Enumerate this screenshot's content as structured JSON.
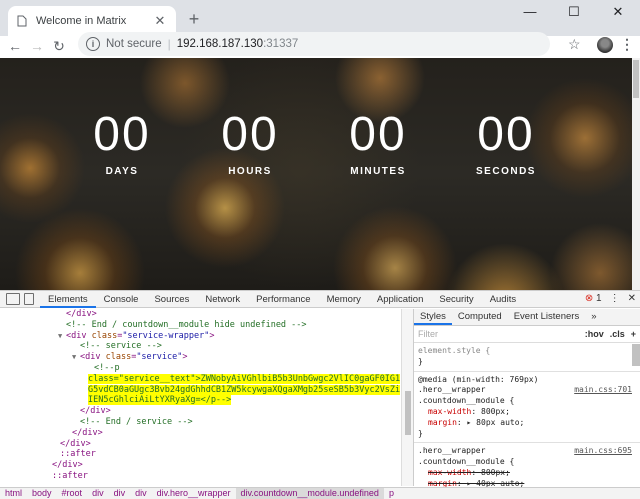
{
  "browser": {
    "tab_title": "Welcome in Matrix",
    "tab_close": "✕",
    "new_tab": "+",
    "win_min": "—",
    "win_max": "☐",
    "win_close": "✕",
    "security_label": "Not secure",
    "url_host": "192.168.187.130",
    "url_port": ":31337"
  },
  "countdown": [
    {
      "value": "00",
      "label": "DAYS"
    },
    {
      "value": "00",
      "label": "HOURS"
    },
    {
      "value": "00",
      "label": "MINUTES"
    },
    {
      "value": "00",
      "label": "SECONDS"
    }
  ],
  "devtools": {
    "tabs": [
      "Elements",
      "Console",
      "Sources",
      "Network",
      "Performance",
      "Memory",
      "Application",
      "Security",
      "Audits"
    ],
    "active_tab": "Elements",
    "error_count": "1",
    "more": "⋮",
    "close": "✕",
    "dom_lines": {
      "l1": "</div>",
      "l2": "<!-- End / countdown__module hide undefined -->",
      "l3_tag": "<div ",
      "l3_attr": "class",
      "l3_val": "\"service-wrapper\"",
      "l4": "<!-- service -->",
      "l5_tag": "<div ",
      "l5_attr": "class",
      "l5_val": "\"service\"",
      "l6": "<!--p",
      "l7": "class=\"service__text\">ZWNobyAiVGhlbiB5b3UnbGwgc2VlIC0gaGF0IG10IG1zIGc",
      "l8": "G5vdCB0aGUgc3Bvb24gdGhhdCB1ZW5kcywgaXQgaXMgb25seSB5b3Vyc2VsZi4gIiA+",
      "l9": "IEN5cGhlciAiLtYXRyaXg=</p-->",
      "l10": "</div>",
      "l11": "<!-- End / service -->",
      "l12": "</div>",
      "l13": "</div>",
      "l14": "::after",
      "l15": "</div>",
      "l16": "::after"
    },
    "styles_tabs": [
      "Styles",
      "Computed",
      "Event Listeners"
    ],
    "styles_more": "»",
    "filter_placeholder": "Filter",
    "hov": ":hov",
    "cls": ".cls",
    "add": "+",
    "rules": {
      "element_style": "element.style {",
      "close_brace": "}",
      "media": "@media (min-width: 769px)",
      "sel1a": ".hero__wrapper",
      "sel1b": ".countdown__module {",
      "src1": "main.css:701",
      "p1": "max-width",
      "v1": "800px;",
      "p2": "margin",
      "v2": "▸ 80px auto;",
      "sel2a": ".hero__wrapper",
      "sel2b": ".countdown__module {",
      "src2": "main.css:695",
      "p3": "max-width",
      "v3": "800px;",
      "p4": "margin",
      "v4": "▸ 40px auto;"
    },
    "breadcrumb": [
      "html",
      "body",
      "#root",
      "div",
      "div",
      "div",
      "div.hero__wrapper",
      "div.countdown__module.undefined",
      "p"
    ]
  }
}
